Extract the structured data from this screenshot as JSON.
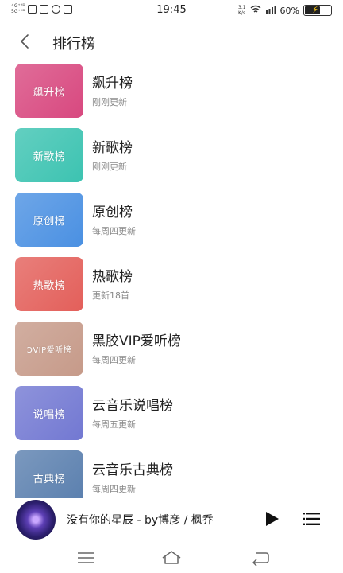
{
  "status_bar": {
    "network_left": "4G⁺ᴴᴰ\n5G⁺ᴴᴰ",
    "time": "19:45",
    "network_right": "3.1\nK/s",
    "battery": "60%",
    "battery_level": 0.6
  },
  "header": {
    "title": "排行榜"
  },
  "charts": [
    {
      "cover_text": "飙升榜",
      "title": "飙升榜",
      "subtitle": "刚刚更新",
      "color": "#d8487f"
    },
    {
      "cover_text": "新歌榜",
      "title": "新歌榜",
      "subtitle": "刚刚更新",
      "color": "#3cc3b1"
    },
    {
      "cover_text": "原创榜",
      "title": "原创榜",
      "subtitle": "每周四更新",
      "color": "#4a90e2"
    },
    {
      "cover_text": "热歌榜",
      "title": "热歌榜",
      "subtitle": "更新18首",
      "color": "#e35f5a"
    },
    {
      "cover_text": "ƆVIP爱听榜",
      "title": "黑胶VIP爱听榜",
      "subtitle": "每周四更新",
      "color": "#c69a89"
    },
    {
      "cover_text": "说唱榜",
      "title": "云音乐说唱榜",
      "subtitle": "每周五更新",
      "color": "#7278d2"
    },
    {
      "cover_text": "古典榜",
      "title": "云音乐古典榜",
      "subtitle": "每周四更新",
      "color": "#5a7fae"
    }
  ],
  "player": {
    "song": "没有你的星辰 - by博彦 / 枫乔"
  },
  "icons": {
    "back": "chevron-left-icon",
    "play": "play-icon",
    "playlist": "playlist-icon",
    "nav_menu": "menu-icon",
    "nav_home": "home-icon",
    "nav_back": "return-icon"
  }
}
